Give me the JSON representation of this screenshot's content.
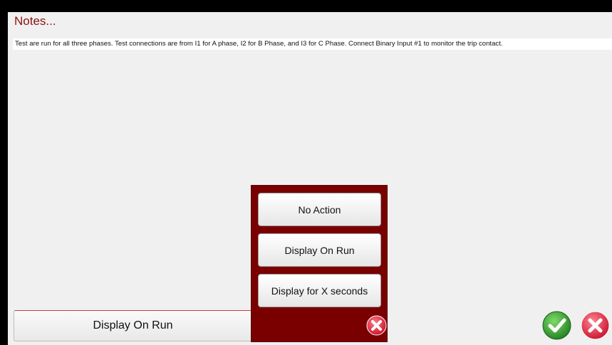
{
  "dialog": {
    "title": "Notes...",
    "notes_text": "Test are run for all three phases. Test connections are from I1 for A phase, I2 for B Phase, and I3 for C Phase. Connect Binary Input #1 to monitor the trip contact."
  },
  "display_option": {
    "selected_value": "Display On Run"
  },
  "dropdown": {
    "options": [
      "No Action",
      "Display On Run",
      "Display for X seconds"
    ],
    "close_icon": "close-icon"
  },
  "footer": {
    "confirm_icon": "check-icon",
    "cancel_icon": "close-icon"
  },
  "colors": {
    "title": "#8b1010",
    "popup_bg": "#7a0000",
    "confirm": "#2e9b2e",
    "cancel": "#d8283a"
  }
}
